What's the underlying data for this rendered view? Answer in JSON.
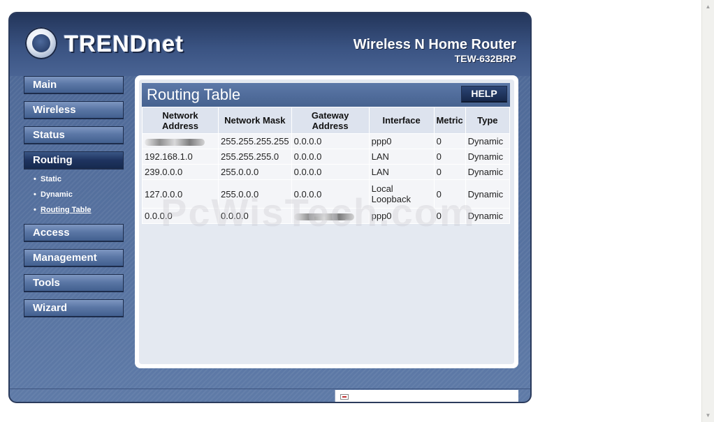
{
  "brand": {
    "logo_text": "TRENDnet",
    "product_name": "Wireless N Home Router",
    "model": "TEW-632BRP"
  },
  "nav": {
    "main": "Main",
    "wireless": "Wireless",
    "status": "Status",
    "routing": "Routing",
    "routing_sub": {
      "static": "Static",
      "dynamic": "Dynamic",
      "routing_table": "Routing Table"
    },
    "access": "Access",
    "management": "Management",
    "tools": "Tools",
    "wizard": "Wizard"
  },
  "page": {
    "title": "Routing Table",
    "help_label": "HELP"
  },
  "table": {
    "headers": [
      "Network Address",
      "Network Mask",
      "Gateway Address",
      "Interface",
      "Metric",
      "Type"
    ],
    "rows": [
      [
        "",
        "255.255.255.255",
        "0.0.0.0",
        "ppp0",
        "0",
        "Dynamic"
      ],
      [
        "192.168.1.0",
        "255.255.255.0",
        "0.0.0.0",
        "LAN",
        "0",
        "Dynamic"
      ],
      [
        "239.0.0.0",
        "255.0.0.0",
        "0.0.0.0",
        "LAN",
        "0",
        "Dynamic"
      ],
      [
        "127.0.0.0",
        "255.0.0.0",
        "0.0.0.0",
        "Local Loopback",
        "0",
        "Dynamic"
      ],
      [
        "0.0.0.0",
        "0.0.0.0",
        "",
        "ppp0",
        "0",
        "Dynamic"
      ]
    ]
  },
  "watermark": "PcWisTech.com"
}
